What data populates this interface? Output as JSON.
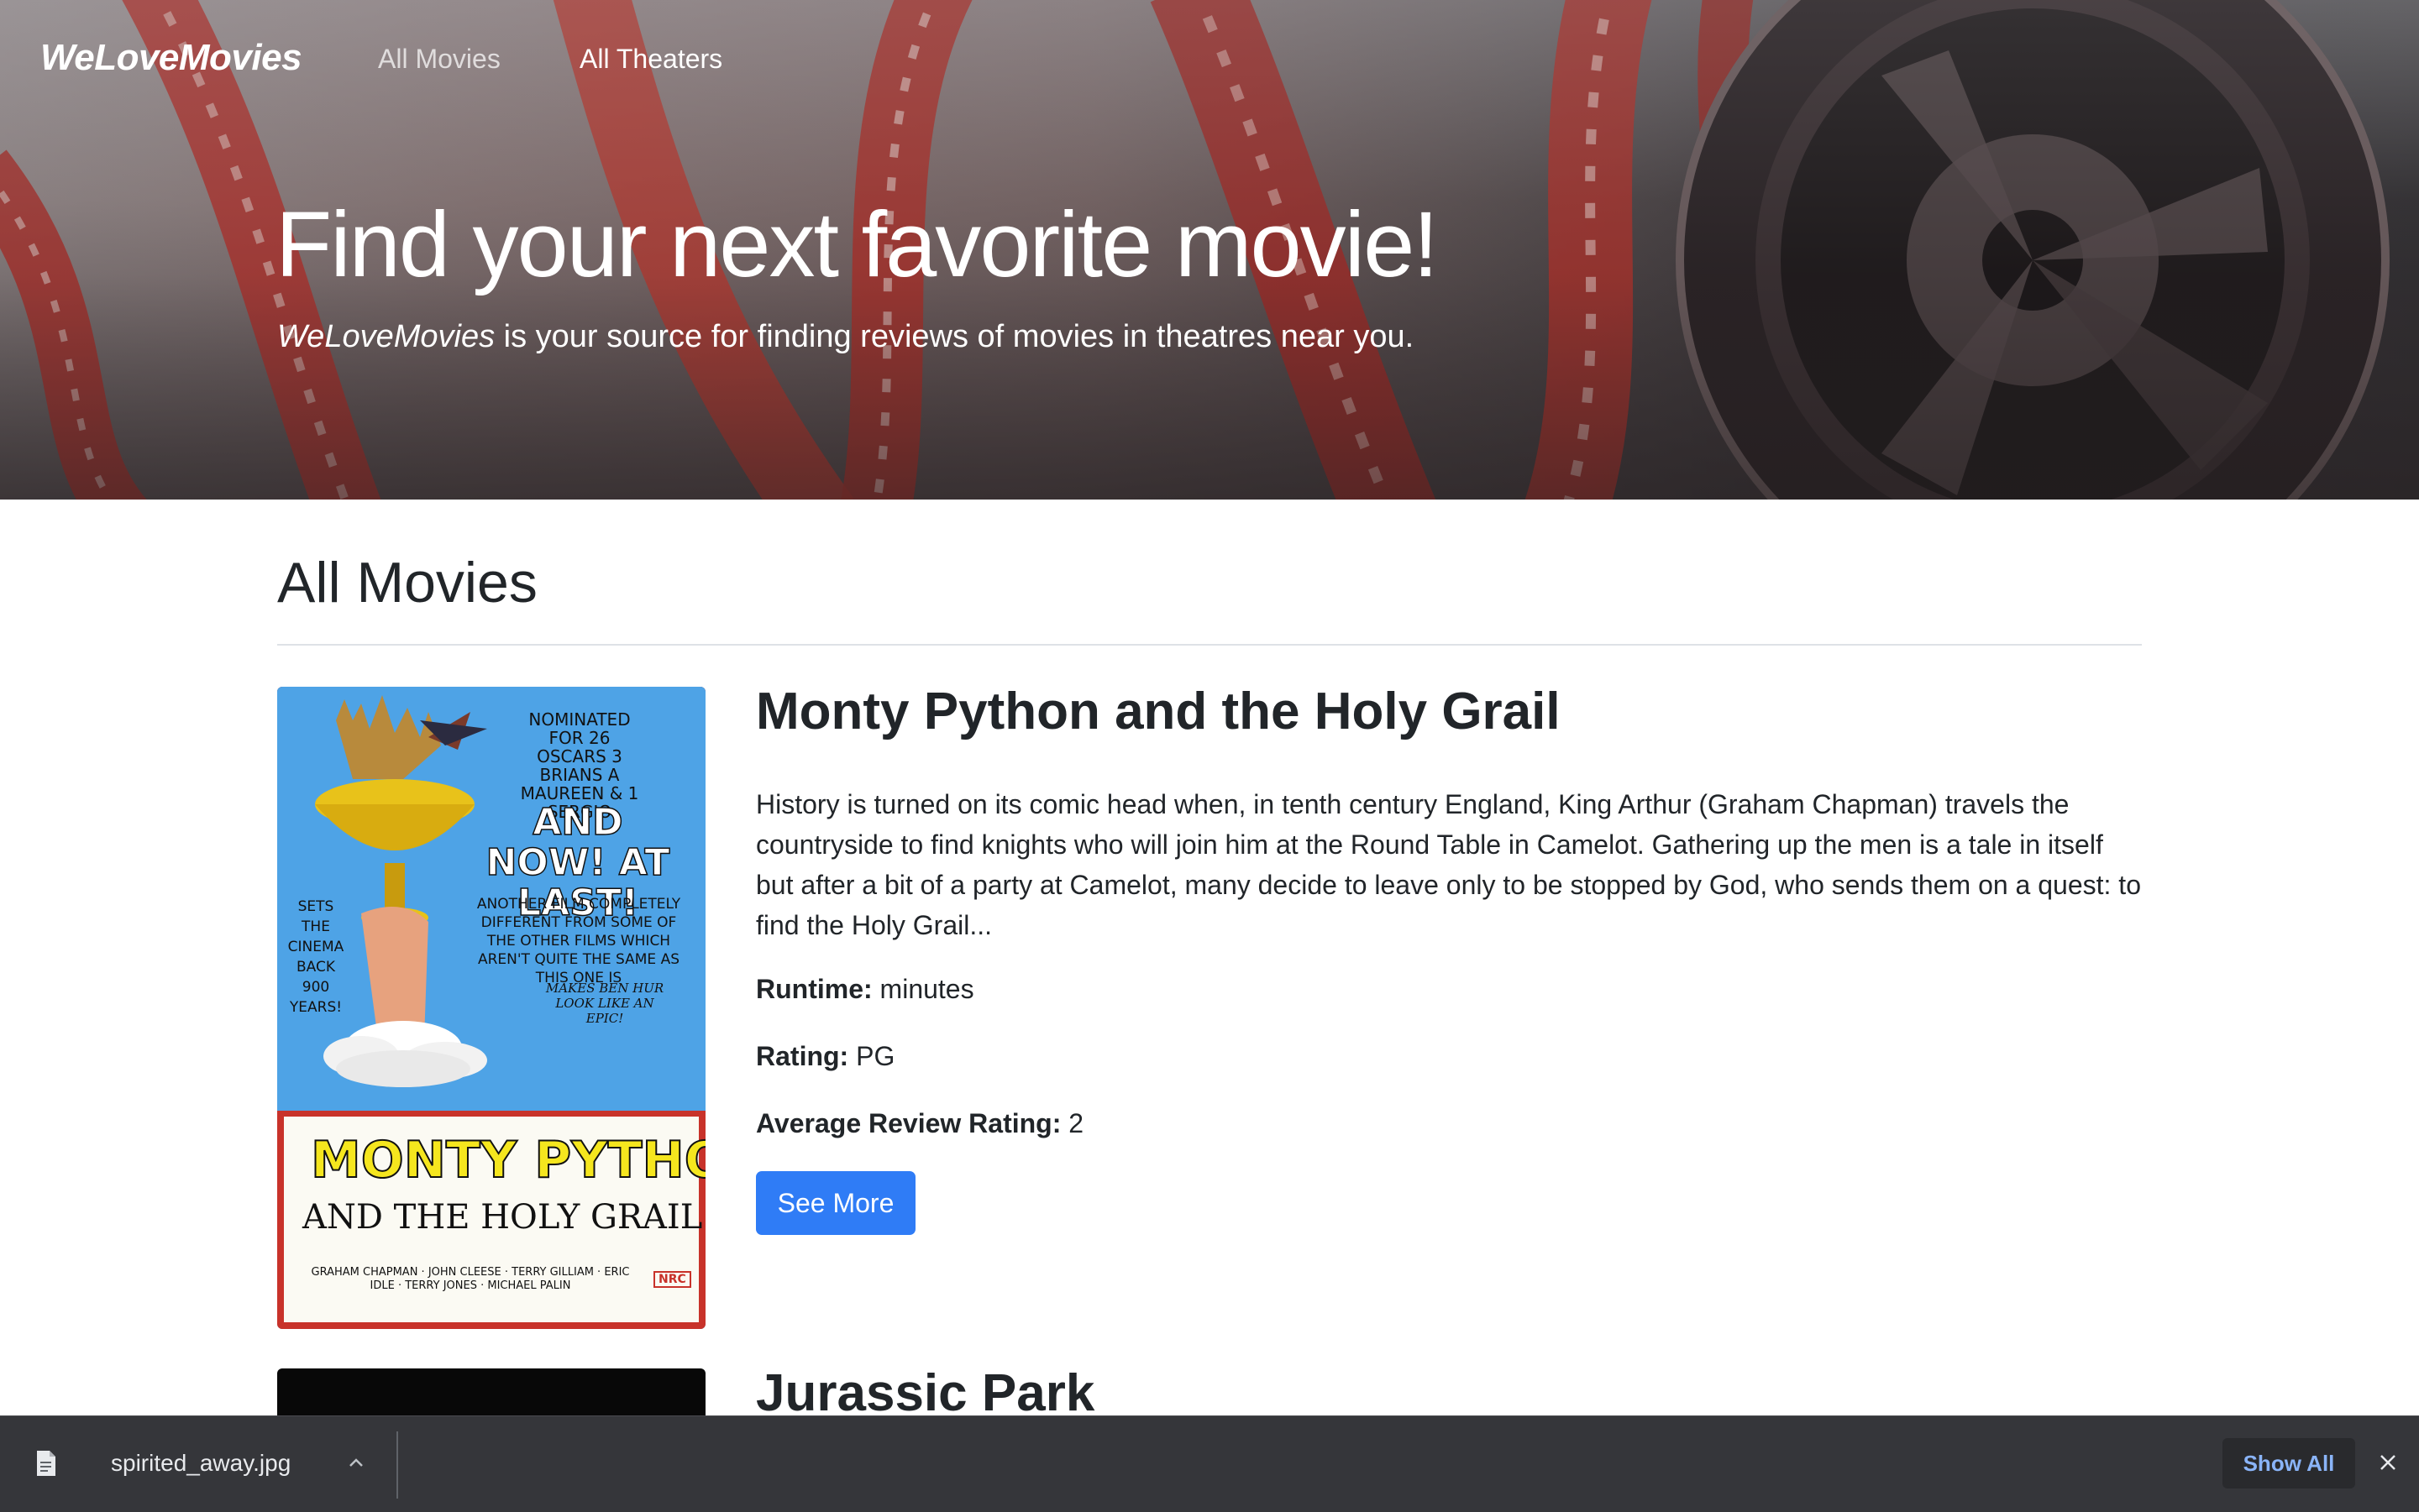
{
  "navbar": {
    "brand": "WeLoveMovies",
    "links": [
      {
        "label": "All Movies",
        "active": false
      },
      {
        "label": "All Theaters",
        "active": true
      }
    ]
  },
  "hero": {
    "title": "Find your next favorite movie!",
    "subtitle_brand": "WeLoveMovies",
    "subtitle_rest": " is your source for finding reviews of movies in theatres near you."
  },
  "main": {
    "section_title": "All Movies",
    "movies": [
      {
        "title": "Monty Python and the Holy Grail",
        "description": "History is turned on its comic head when, in tenth century England, King Arthur (Graham Chapman) travels the countryside to find knights who will join him at the Round Table in Camelot. Gathering up the men is a tale in itself but after a bit of a party at Camelot, many decide to leave only to be stopped by God, who sends them on a quest: to find the Holy Grail...",
        "runtime_label": "Runtime:",
        "runtime_value": " minutes",
        "rating_label": "Rating:",
        "rating_value": " PG",
        "avg_label": "Average Review Rating:",
        "avg_value": " 2",
        "button_label": "See More",
        "poster": {
          "top_text": "NOMINATED FOR 26 OSCARS 3 BRIANS A MAUREEN & 1 SERGIO",
          "headline": "AND NOW! AT LAST!",
          "tagline": "ANOTHER FILM COMPLETELY DIFFERENT FROM SOME OF THE OTHER FILMS WHICH AREN'T QUITE THE SAME AS THIS ONE IS",
          "side_text": "SETS THE CINEMA BACK 900 YEARS!",
          "ben_hur": "MAKES BEN HUR LOOK LIKE AN EPIC!",
          "title_line1": "MONTY PYTHON",
          "title_line2": "AND THE HOLY GRAIL",
          "cast": "GRAHAM CHAPMAN · JOHN CLEESE · TERRY GILLIAM · ERIC IDLE · TERRY JONES · MICHAEL PALIN",
          "badge": "NRC",
          "colors": {
            "sky": "#4ea3e6",
            "grail": "#e8c21a",
            "frame": "#c8322a",
            "title": "#f5e61e"
          }
        }
      },
      {
        "title": "Jurassic Park"
      }
    ]
  },
  "download_bar": {
    "file_name": "spirited_away.jpg",
    "show_all_label": "Show All",
    "icons": [
      "file-icon",
      "chevron-up-icon",
      "close-icon"
    ]
  },
  "theme": {
    "primary": "#2f7cf6",
    "download_bar_bg": "#35363a",
    "link_blue": "#8ab4f8"
  }
}
